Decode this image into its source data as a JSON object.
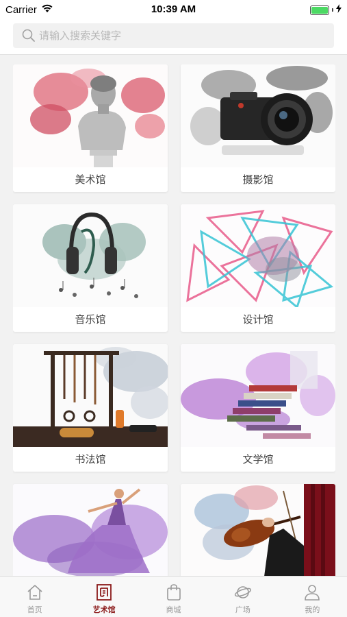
{
  "status_bar": {
    "carrier": "Carrier",
    "time": "10:39 AM"
  },
  "search": {
    "placeholder": "请输入搜索关键字",
    "value": ""
  },
  "categories": [
    {
      "label": "美术馆",
      "icon": "sculpture-ink-image"
    },
    {
      "label": "摄影馆",
      "icon": "camera-ink-image"
    },
    {
      "label": "音乐馆",
      "icon": "headphones-ink-image"
    },
    {
      "label": "设计馆",
      "icon": "geometric-ink-image"
    },
    {
      "label": "书法馆",
      "icon": "brush-rack-ink-image"
    },
    {
      "label": "文学馆",
      "icon": "books-ink-image"
    },
    {
      "label": "",
      "icon": "dancer-ink-image"
    },
    {
      "label": "",
      "icon": "violin-ink-image"
    }
  ],
  "tabs": [
    {
      "label": "首页",
      "icon": "home-icon"
    },
    {
      "label": "艺术馆",
      "icon": "art-gallery-icon",
      "active": true
    },
    {
      "label": "商城",
      "icon": "shopping-bag-icon"
    },
    {
      "label": "广场",
      "icon": "planet-icon"
    },
    {
      "label": "我的",
      "icon": "profile-icon"
    }
  ],
  "colors": {
    "accent": "#8b1a1a",
    "tab_inactive": "#999999",
    "battery": "#4cd964"
  }
}
